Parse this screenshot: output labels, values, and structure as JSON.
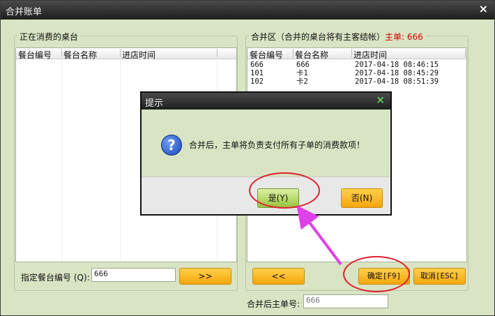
{
  "window": {
    "title": "合并账单",
    "close_glyph": "×"
  },
  "left_panel": {
    "title": "正在消费的桌台",
    "columns": [
      "餐台编号",
      "餐台名称",
      "进店时间"
    ],
    "rows": [],
    "table_input_label": "指定餐台编号 (Q):",
    "table_input_value": "666",
    "add_button_label": ">>"
  },
  "right_panel": {
    "title": "合并区（合并的桌台将有主客结帐）",
    "main_order_label": "主单: 666",
    "columns": [
      "餐台编号",
      "餐台名称",
      "进店时间"
    ],
    "rows": [
      [
        "666",
        "666",
        "2017-04-18 08:46:15"
      ],
      [
        "101",
        "卡1",
        "2017-04-18 08:45:29"
      ],
      [
        "102",
        "卡2",
        "2017-04-18 08:51:39"
      ]
    ],
    "remove_button_label": "<<",
    "confirm_button_label": "确定[F9]",
    "cancel_button_label": "取消[ESC]"
  },
  "footer": {
    "main_no_label": "合并后主单号:",
    "main_no_value": "666"
  },
  "dialog": {
    "title": "提示",
    "close_glyph": "×",
    "icon_glyph": "?",
    "message": "合并后，主单将负责支付所有子单的消费款项！",
    "yes_label": "是(Y)",
    "no_label": "否(N)"
  },
  "annotation_color": "#e02030",
  "arrow_color": "#e040e8"
}
